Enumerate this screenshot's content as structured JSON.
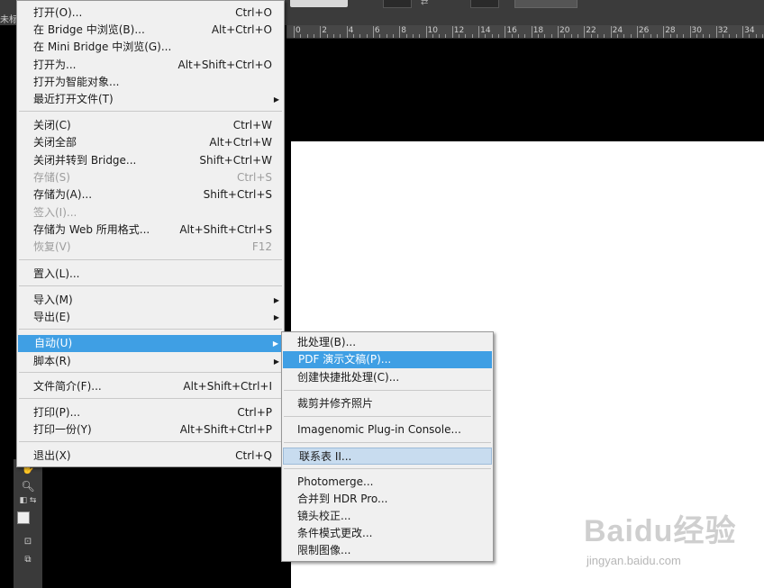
{
  "topbar": {
    "tab_title": "未标题"
  },
  "ruler": {
    "labels": [
      "0",
      "2",
      "4",
      "6",
      "8",
      "10",
      "12",
      "14",
      "16",
      "18",
      "20",
      "22",
      "24",
      "26",
      "28",
      "30",
      "32",
      "34"
    ]
  },
  "file_menu": {
    "items": [
      {
        "label": "打开(O)...",
        "shortcut": "Ctrl+O",
        "disabled": false
      },
      {
        "label": "在 Bridge 中浏览(B)...",
        "shortcut": "Alt+Ctrl+O",
        "disabled": false
      },
      {
        "label": "在 Mini Bridge 中浏览(G)...",
        "shortcut": "",
        "disabled": false
      },
      {
        "label": "打开为...",
        "shortcut": "Alt+Shift+Ctrl+O",
        "disabled": false
      },
      {
        "label": "打开为智能对象...",
        "shortcut": "",
        "disabled": false
      },
      {
        "label": "最近打开文件(T)",
        "shortcut": "",
        "disabled": false,
        "submenu": true
      },
      {
        "label": "关闭(C)",
        "shortcut": "Ctrl+W",
        "disabled": false
      },
      {
        "label": "关闭全部",
        "shortcut": "Alt+Ctrl+W",
        "disabled": false
      },
      {
        "label": "关闭并转到 Bridge...",
        "shortcut": "Shift+Ctrl+W",
        "disabled": false
      },
      {
        "label": "存储(S)",
        "shortcut": "Ctrl+S",
        "disabled": true
      },
      {
        "label": "存储为(A)...",
        "shortcut": "Shift+Ctrl+S",
        "disabled": false
      },
      {
        "label": "签入(I)...",
        "shortcut": "",
        "disabled": true
      },
      {
        "label": "存储为 Web 所用格式...",
        "shortcut": "Alt+Shift+Ctrl+S",
        "disabled": false
      },
      {
        "label": "恢复(V)",
        "shortcut": "F12",
        "disabled": true
      },
      {
        "label": "置入(L)...",
        "shortcut": "",
        "disabled": false
      },
      {
        "label": "导入(M)",
        "shortcut": "",
        "disabled": false,
        "submenu": true
      },
      {
        "label": "导出(E)",
        "shortcut": "",
        "disabled": false,
        "submenu": true
      },
      {
        "label": "自动(U)",
        "shortcut": "",
        "disabled": false,
        "submenu": true,
        "highlighted": true
      },
      {
        "label": "脚本(R)",
        "shortcut": "",
        "disabled": false,
        "submenu": true
      },
      {
        "label": "文件简介(F)...",
        "shortcut": "Alt+Shift+Ctrl+I",
        "disabled": false
      },
      {
        "label": "打印(P)...",
        "shortcut": "Ctrl+P",
        "disabled": false
      },
      {
        "label": "打印一份(Y)",
        "shortcut": "Alt+Shift+Ctrl+P",
        "disabled": false
      },
      {
        "label": "退出(X)",
        "shortcut": "Ctrl+Q",
        "disabled": false
      }
    ]
  },
  "automate_menu": {
    "items": [
      {
        "label": "批处理(B)..."
      },
      {
        "label": "PDF 演示文稿(P)...",
        "highlighted": true
      },
      {
        "label": "创建快捷批处理(C)..."
      },
      {
        "label": "裁剪并修齐照片"
      },
      {
        "label": "Imagenomic Plug-in Console..."
      },
      {
        "label": "联系表 II...",
        "hover": true
      },
      {
        "label": "Photomerge..."
      },
      {
        "label": "合并到 HDR Pro..."
      },
      {
        "label": "镜头校正..."
      },
      {
        "label": "条件模式更改..."
      },
      {
        "label": "限制图像..."
      }
    ]
  },
  "watermark": {
    "brand": "Baidu经验",
    "url": "jingyan.baidu.com"
  },
  "colors": {
    "highlight": "#3f9fe4",
    "menu_bg": "#f0f0f0",
    "disabled": "#9d9d9d"
  }
}
